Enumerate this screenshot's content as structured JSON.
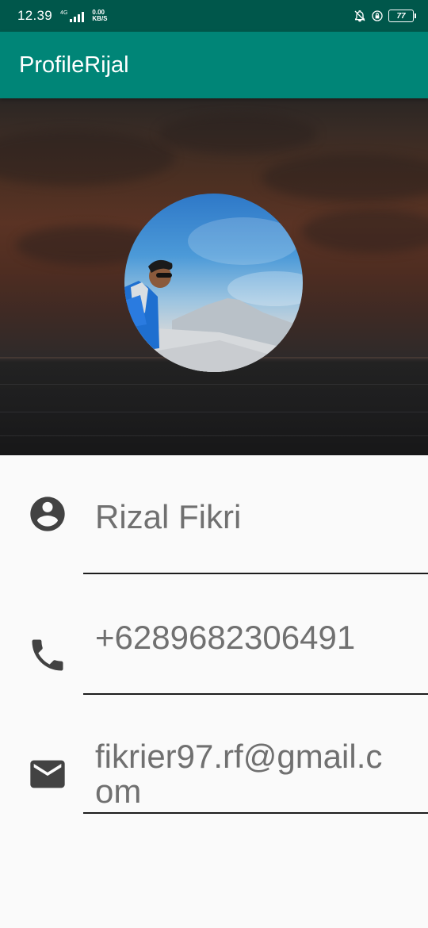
{
  "status_bar": {
    "time": "12.39",
    "network": "4G",
    "speed_value": "0.00",
    "speed_unit": "KB/S",
    "battery": "77",
    "icons": [
      "bell-off-icon",
      "lock-rotation-icon"
    ]
  },
  "app_bar": {
    "title": "ProfileRijal",
    "color": "#008577",
    "status_color": "#00574b"
  },
  "header": {
    "background": "sunset-sea-photo",
    "avatar": "profile-photo"
  },
  "profile": {
    "name": "Rizal Fikri",
    "phone": "+6289682306491",
    "email": "fikrier97.rf@gmail.com"
  },
  "icons": {
    "name": "account-circle-icon",
    "phone": "phone-icon",
    "email": "email-icon",
    "color": "#424242"
  }
}
